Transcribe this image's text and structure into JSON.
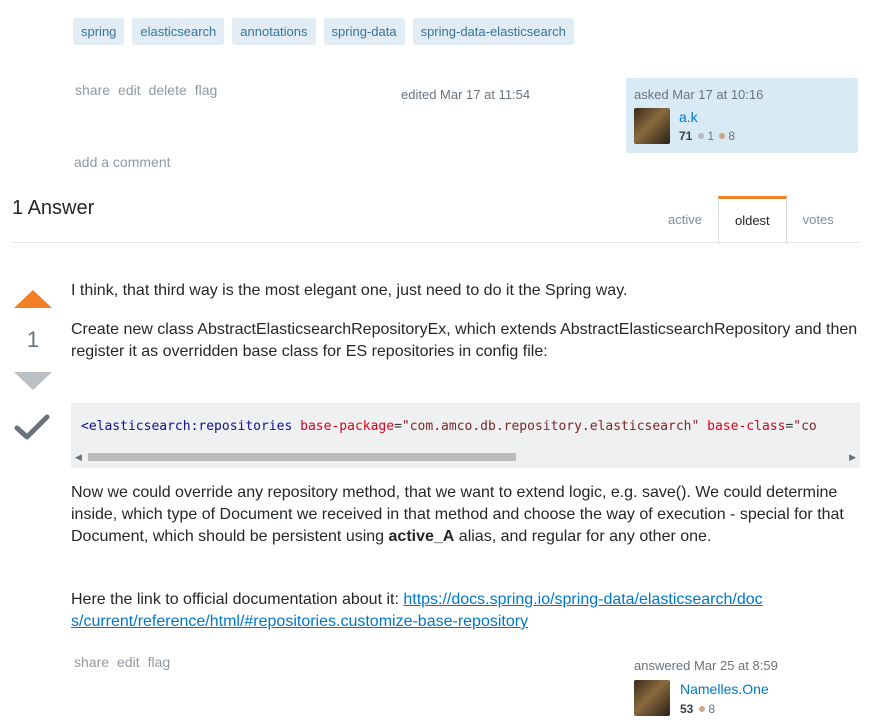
{
  "question": {
    "tags": [
      "spring",
      "elasticsearch",
      "annotations",
      "spring-data",
      "spring-data-elasticsearch"
    ],
    "menu": {
      "share": "share",
      "edit": "edit",
      "delete": "delete",
      "flag": "flag"
    },
    "edited": "edited Mar 17 at 11:54",
    "asked": "asked Mar 17 at 10:16",
    "user": {
      "name": "a.k",
      "rep": "71",
      "silver": "1",
      "bronze": "8"
    },
    "add_comment": "add a comment"
  },
  "answers_header": {
    "count_label": "1 Answer",
    "tabs": [
      {
        "label": "active"
      },
      {
        "label": "oldest"
      },
      {
        "label": "votes"
      }
    ]
  },
  "answer": {
    "votes": "1",
    "p1": "I think, that third way is the most elegant one, just need to do it the Spring way.",
    "p2": "Create new class AbstractElasticsearchRepositoryEx, which extends AbstractElasticsearchRepository and then register it as overridden base class for ES repositories in config file:",
    "code": {
      "tag": "<elasticsearch:repositories",
      "attr1": "base-package",
      "val1": "\"com.amco.db.repository.elasticsearch\"",
      "attr2": "base-class",
      "val2": "\"co"
    },
    "p3_before": "Now we could override any repository method, that we want to extend logic, e.g. save(). We could determine inside, which type of Document we received in that method and choose the way of execution - special for that Document, which should be persistent using ",
    "p3_bold": "active_A",
    "p3_after": " alias, and regular for any other one.",
    "p4_before": "Here the link to official documentation about it: ",
    "p4_link": "https://docs.spring.io/spring-data/elasticsearch/docs/current/reference/html/#repositories.customize-base-repository",
    "menu": {
      "share": "share",
      "edit": "edit",
      "flag": "flag"
    },
    "answered": "answered Mar 25 at 8:59",
    "user": {
      "name": "Namelles.One",
      "rep": "53",
      "bronze": "8"
    }
  },
  "colors": {
    "accent": "#f48024",
    "link": "#0077cc",
    "tag_bg": "#e1ecf4",
    "owner_bg": "#d9eaf7"
  }
}
